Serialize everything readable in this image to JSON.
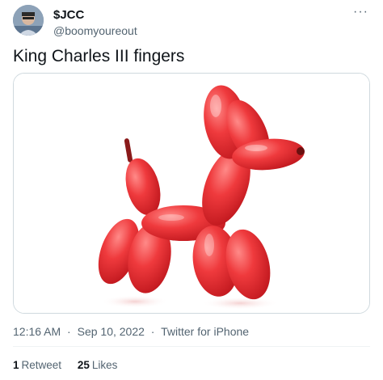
{
  "author": {
    "display_name": "$JCC",
    "handle": "@boomyoureout"
  },
  "icons": {
    "more": "more-options-icon",
    "avatar": "avatar"
  },
  "tweet": {
    "text": "King Charles III fingers",
    "time": "12:16 AM",
    "date": "Sep 10, 2022",
    "source": "Twitter for iPhone",
    "separator": "·"
  },
  "stats": {
    "retweets_count": "1",
    "retweets_label": "Retweet",
    "likes_count": "25",
    "likes_label": "Likes"
  },
  "colors": {
    "text_primary": "#0f1419",
    "text_secondary": "#536471",
    "border": "#cfd9de",
    "balloon": "#e8373a"
  }
}
